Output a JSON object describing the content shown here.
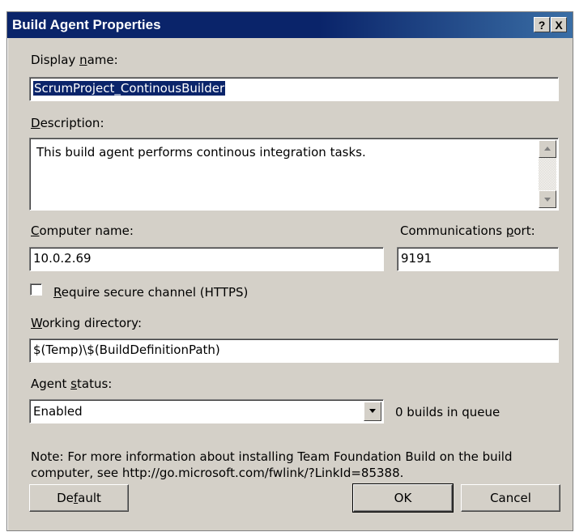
{
  "window": {
    "title": "Build Agent Properties",
    "help_button": "?",
    "close_button": "X"
  },
  "display_name": {
    "label": "Display name:",
    "value": "ScrumProject_ContinousBuilder"
  },
  "description": {
    "label": "Description:",
    "value": "This build agent performs continous integration tasks."
  },
  "computer_name": {
    "label": "Computer name:",
    "value": "10.0.2.69"
  },
  "communications_port": {
    "label": "Communications port:",
    "value": "9191"
  },
  "secure_channel": {
    "label": "Require secure channel (HTTPS)",
    "checked": false
  },
  "working_directory": {
    "label": "Working directory:",
    "value": "$(Temp)\\$(BuildDefinitionPath)"
  },
  "agent_status": {
    "label": "Agent status:",
    "value": "Enabled",
    "queue_text": "0 builds in queue"
  },
  "note": "Note: For more information about installing Team Foundation Build on the build computer, see http://go.microsoft.com/fwlink/?LinkId=85388.",
  "buttons": {
    "default": "Default",
    "ok": "OK",
    "cancel": "Cancel"
  }
}
